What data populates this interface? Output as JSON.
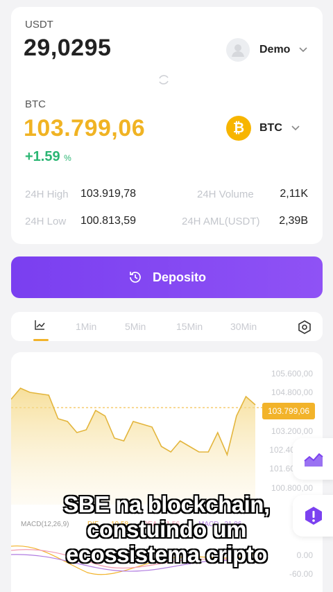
{
  "account": {
    "currency_label": "USDT",
    "balance": "29,0295",
    "mode_label": "Demo"
  },
  "asset": {
    "symbol_label": "BTC",
    "price": "103.799,06",
    "change_value": "+1.59",
    "change_unit": "%",
    "selector_label": "BTC",
    "coin_glyph": "₿"
  },
  "stats": {
    "high_label": "24H High",
    "high_value": "103.919,78",
    "low_label": "24H Low",
    "low_value": "100.813,59",
    "volume_label": "24H Volume",
    "volume_value": "2,11K",
    "aml_label": "24H AML(USDT)",
    "aml_value": "2,39B"
  },
  "deposit": {
    "label": "Deposito"
  },
  "tabs": [
    "1Min",
    "5Min",
    "15Min",
    "30Min"
  ],
  "icons": {
    "chart_tab": "line-chart-icon",
    "settings": "settings-hexagon-icon",
    "trend": "trend-up-icon",
    "alert": "alert-icon"
  },
  "colors": {
    "price": "#f0b323",
    "change": "#2bb673",
    "deposit": "#7b41f0",
    "float_icon": "#7b41f0"
  },
  "chart_data": {
    "type": "area",
    "y_ticks": [
      "105.600,00",
      "104.800,00",
      "103.200,00",
      "102.40",
      "101.60",
      "100.800,00"
    ],
    "current_price_tag": "103.799,06",
    "values": [
      104.1,
      104.5,
      104.35,
      104.3,
      104.25,
      103.4,
      103.3,
      102.9,
      103.0,
      103.7,
      103.5,
      102.7,
      102.6,
      103.3,
      103.2,
      103.1,
      102.4,
      102.2,
      102.6,
      102.4,
      102.2,
      102.2,
      102.9,
      102.1,
      103.5,
      104.2,
      103.9
    ],
    "macd_labels": [
      "MACD(12,26,9)",
      "DIF",
      "10.58",
      "DEA",
      "21.56",
      "MACD",
      "-21.96"
    ],
    "macd_ticks": [
      "0.00",
      "-60.00"
    ]
  },
  "caption": {
    "line1": "SBE na blockchain,",
    "line2": "constuindo um",
    "line3": "ecossistema cripto"
  }
}
